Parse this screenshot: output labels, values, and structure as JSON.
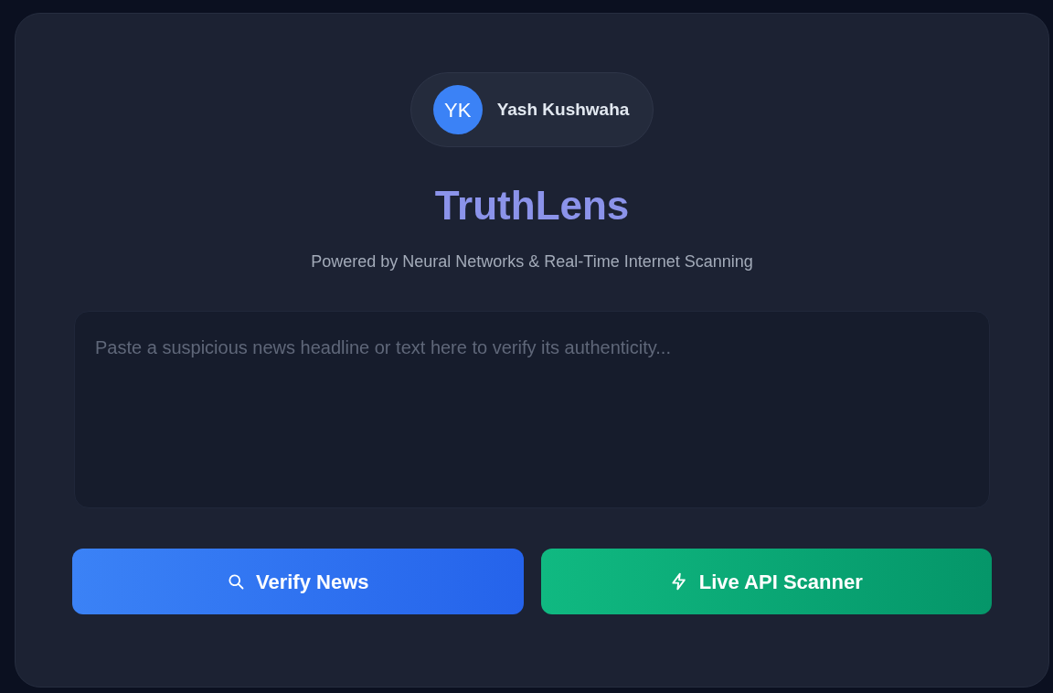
{
  "user": {
    "initials": "YK",
    "name": "Yash Kushwaha"
  },
  "title": "TruthLens",
  "subtitle": "Powered by Neural Networks & Real-Time Internet Scanning",
  "input": {
    "placeholder": "Paste a suspicious news headline or text here to verify its authenticity..."
  },
  "buttons": [
    {
      "label": "Verify News",
      "kind": "search"
    },
    {
      "label": "Live API Scanner",
      "kind": "bolt"
    }
  ]
}
